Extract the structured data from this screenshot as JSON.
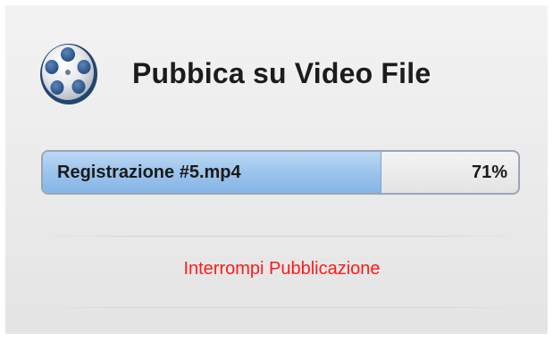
{
  "dialog": {
    "title": "Pubbica su Video File",
    "icon": "film-reel-icon"
  },
  "progress": {
    "label": "Registrazione #5.mp4",
    "percent_text": "71%",
    "value": 0.71,
    "fill_color": "#9cc4ec"
  },
  "actions": {
    "stop_label": "Interrompi Pubblicazione",
    "stop_color": "#ff1a1a"
  }
}
